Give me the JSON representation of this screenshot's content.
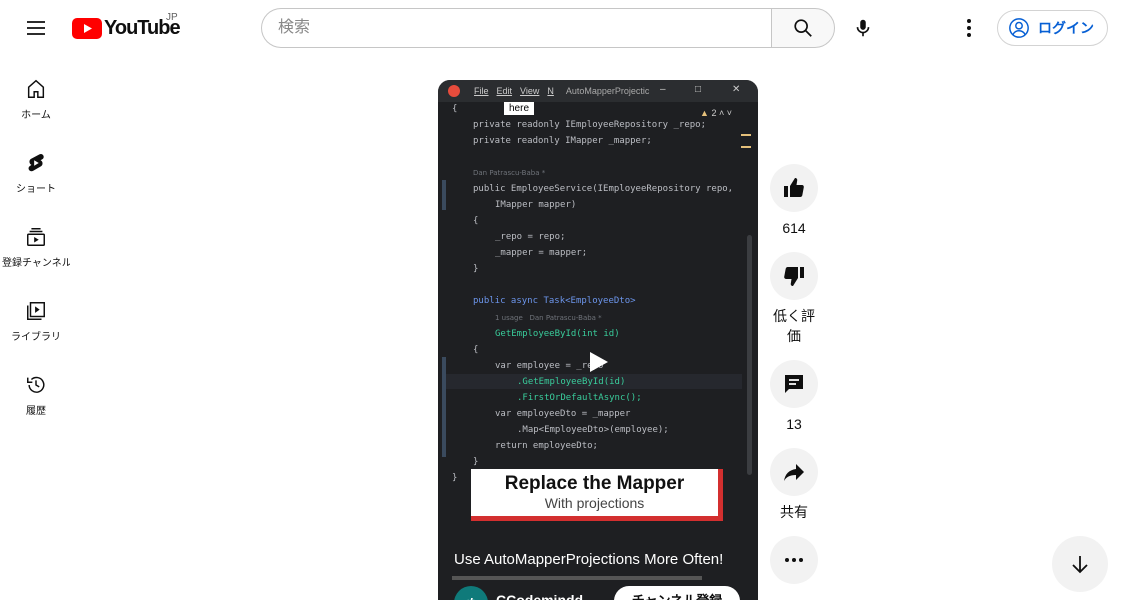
{
  "header": {
    "logo_text": "YouTube",
    "region": "JP",
    "search_placeholder": "検索",
    "login_label": "ログイン"
  },
  "sidebar": {
    "items": [
      {
        "label": "ホーム",
        "icon": "home-icon"
      },
      {
        "label": "ショート",
        "icon": "shorts-icon"
      },
      {
        "label": "登録チャンネル",
        "icon": "subscriptions-icon"
      },
      {
        "label": "ライブラリ",
        "icon": "library-icon"
      },
      {
        "label": "履歴",
        "icon": "history-icon"
      }
    ]
  },
  "video": {
    "ide_menu": [
      "File",
      "Edit",
      "View",
      "N"
    ],
    "ide_project": "AutoMapperProjectic",
    "tooltip": "here",
    "warning_count": "2",
    "code_lines": [
      "{",
      "private readonly IEmployeeRepository _repo;",
      "private readonly IMapper _mapper;",
      "Dan Patrascu-Baba *",
      "public EmployeeService(IEmployeeRepository repo,",
      "IMapper mapper)",
      "{",
      "_repo = repo;",
      "_mapper = mapper;",
      "}",
      "public async Task<EmployeeDto>",
      "1 usage   Dan Patrascu-Baba *",
      "GetEmployeeById(int id)",
      "{",
      "var employee = _repo",
      ".GetEmployeeById(id)",
      ".FirstOrDefaultAsync();",
      "var employeeDto = _mapper",
      ".Map<EmployeeDto>(employee);",
      "return employeeDto;",
      "}",
      "}"
    ],
    "banner_title": "Replace the Mapper",
    "banner_subtitle": "With projections",
    "title": "Use AutoMapperProjections More Often!",
    "channel_name": "CCodemindd",
    "subscribe_label": "チャンネル登録"
  },
  "actions": {
    "like_count": "614",
    "dislike_label": "低く評価",
    "comment_count": "13",
    "share_label": "共有"
  },
  "colors": {
    "brand_red": "#ff0000",
    "link_blue": "#065fd4",
    "banner_red": "#d32f2f"
  }
}
